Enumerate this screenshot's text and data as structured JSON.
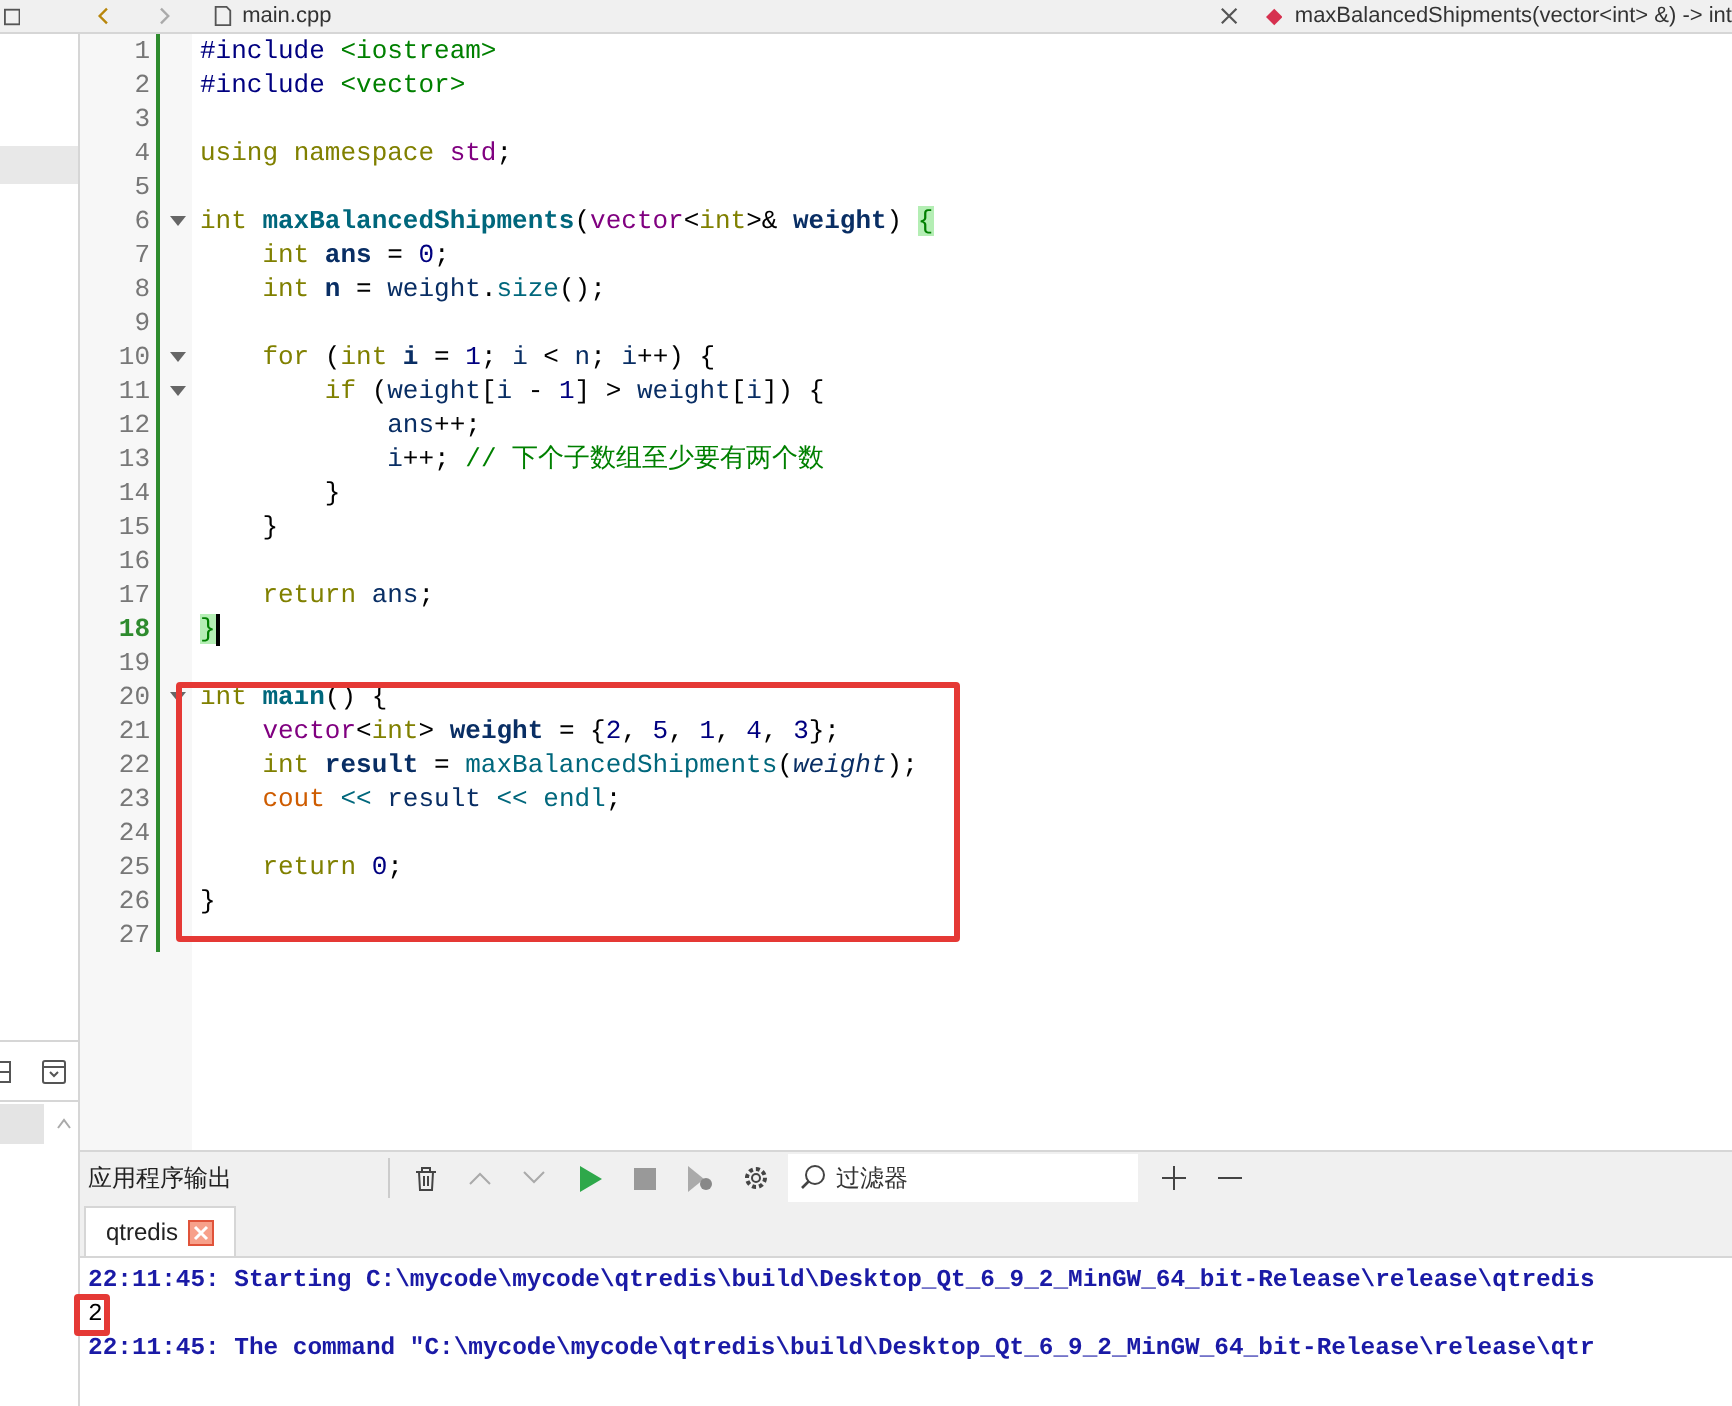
{
  "toolbar": {
    "file": "main.cpp",
    "symbol": "maxBalancedShipments(vector<int> &) -> int"
  },
  "editor": {
    "lines": [
      {
        "number": "1",
        "fold": false,
        "current": false,
        "tokens": [
          {
            "text": "#include",
            "kind": "pp"
          },
          {
            "text": " <iostream>",
            "kind": "inc"
          }
        ]
      },
      {
        "number": "2",
        "fold": false,
        "current": false,
        "tokens": [
          {
            "text": "#include",
            "kind": "pp"
          },
          {
            "text": " <vector>",
            "kind": "inc"
          }
        ]
      },
      {
        "number": "3",
        "fold": false,
        "current": false
      },
      {
        "number": "4",
        "fold": false,
        "current": false,
        "tokens": [
          {
            "text": "using",
            "kind": "kw"
          },
          {
            "text": " namespace",
            "kind": "kw"
          },
          {
            "text": " std",
            "kind": "type"
          },
          {
            "text": ";",
            "kind": "p"
          }
        ]
      },
      {
        "number": "5",
        "fold": false,
        "current": false
      },
      {
        "number": "6",
        "fold": true,
        "current": false,
        "tokens": [
          {
            "text": "int",
            "kind": "kw"
          },
          {
            "text": " maxBalancedShipments",
            "kind": "fndecl"
          },
          {
            "text": "(",
            "kind": "p"
          },
          {
            "text": "vector",
            "kind": "type"
          },
          {
            "text": "<",
            "kind": "p"
          },
          {
            "text": "int",
            "kind": "kw"
          },
          {
            "text": ">& ",
            "kind": "p"
          },
          {
            "text": "weight",
            "kind": "local"
          },
          {
            "text": ") ",
            "kind": "p"
          },
          {
            "text": "{",
            "kind": "match"
          }
        ]
      },
      {
        "number": "7",
        "fold": false,
        "current": false,
        "tokens": [
          {
            "text": "    int",
            "kind": "kw"
          },
          {
            "text": " ans",
            "kind": "local"
          },
          {
            "text": " = ",
            "kind": "p"
          },
          {
            "text": "0",
            "kind": "num"
          },
          {
            "text": ";",
            "kind": "p"
          }
        ]
      },
      {
        "number": "8",
        "fold": false,
        "current": false,
        "tokens": [
          {
            "text": "    int",
            "kind": "kw"
          },
          {
            "text": " n",
            "kind": "local"
          },
          {
            "text": " = ",
            "kind": "p"
          },
          {
            "text": "weight",
            "kind": "var"
          },
          {
            "text": ".",
            "kind": "p"
          },
          {
            "text": "size",
            "kind": "fn"
          },
          {
            "text": "();",
            "kind": "p"
          }
        ]
      },
      {
        "number": "9",
        "fold": false,
        "current": false
      },
      {
        "number": "10",
        "fold": true,
        "current": false,
        "tokens": [
          {
            "text": "    for",
            "kind": "kw"
          },
          {
            "text": " (",
            "kind": "p"
          },
          {
            "text": "int",
            "kind": "kw"
          },
          {
            "text": " i",
            "kind": "local"
          },
          {
            "text": " = ",
            "kind": "p"
          },
          {
            "text": "1",
            "kind": "num"
          },
          {
            "text": "; ",
            "kind": "p"
          },
          {
            "text": "i",
            "kind": "var"
          },
          {
            "text": " < ",
            "kind": "p"
          },
          {
            "text": "n",
            "kind": "var"
          },
          {
            "text": "; ",
            "kind": "p"
          },
          {
            "text": "i",
            "kind": "var"
          },
          {
            "text": "++) {",
            "kind": "p"
          }
        ]
      },
      {
        "number": "11",
        "fold": true,
        "current": false,
        "tokens": [
          {
            "text": "        if",
            "kind": "kw"
          },
          {
            "text": " (",
            "kind": "p"
          },
          {
            "text": "weight",
            "kind": "var"
          },
          {
            "text": "[",
            "kind": "p"
          },
          {
            "text": "i",
            "kind": "var"
          },
          {
            "text": " - ",
            "kind": "p"
          },
          {
            "text": "1",
            "kind": "num"
          },
          {
            "text": "] > ",
            "kind": "p"
          },
          {
            "text": "weight",
            "kind": "var"
          },
          {
            "text": "[",
            "kind": "p"
          },
          {
            "text": "i",
            "kind": "var"
          },
          {
            "text": "]) {",
            "kind": "p"
          }
        ]
      },
      {
        "number": "12",
        "fold": false,
        "current": false,
        "tokens": [
          {
            "text": "            ans",
            "kind": "var"
          },
          {
            "text": "++;",
            "kind": "p"
          }
        ]
      },
      {
        "number": "13",
        "fold": false,
        "current": false,
        "tokens": [
          {
            "text": "            i",
            "kind": "var"
          },
          {
            "text": "++; ",
            "kind": "p"
          },
          {
            "text": "// 下个子数组至少要有两个数",
            "kind": "cmt"
          }
        ]
      },
      {
        "number": "14",
        "fold": false,
        "current": false,
        "tokens": [
          {
            "text": "        }",
            "kind": "p"
          }
        ]
      },
      {
        "number": "15",
        "fold": false,
        "current": false,
        "tokens": [
          {
            "text": "    }",
            "kind": "p"
          }
        ]
      },
      {
        "number": "16",
        "fold": false,
        "current": false
      },
      {
        "number": "17",
        "fold": false,
        "current": false,
        "tokens": [
          {
            "text": "    return",
            "kind": "kw"
          },
          {
            "text": " ans",
            "kind": "var"
          },
          {
            "text": ";",
            "kind": "p"
          }
        ]
      },
      {
        "number": "18",
        "fold": false,
        "current": true,
        "tokens": [
          {
            "text": "}",
            "kind": "match"
          }
        ]
      },
      {
        "number": "19",
        "fold": false,
        "current": false
      },
      {
        "number": "20",
        "fold": true,
        "current": false,
        "tokens": [
          {
            "text": "int",
            "kind": "kw"
          },
          {
            "text": " main",
            "kind": "fndecl"
          },
          {
            "text": "() {",
            "kind": "p"
          }
        ]
      },
      {
        "number": "21",
        "fold": false,
        "current": false,
        "tokens": [
          {
            "text": "    vector",
            "kind": "type"
          },
          {
            "text": "<",
            "kind": "p"
          },
          {
            "text": "int",
            "kind": "kw"
          },
          {
            "text": "> ",
            "kind": "p"
          },
          {
            "text": "weight",
            "kind": "local"
          },
          {
            "text": " = {",
            "kind": "p"
          },
          {
            "text": "2",
            "kind": "num"
          },
          {
            "text": ", ",
            "kind": "p"
          },
          {
            "text": "5",
            "kind": "num"
          },
          {
            "text": ", ",
            "kind": "p"
          },
          {
            "text": "1",
            "kind": "num"
          },
          {
            "text": ", ",
            "kind": "p"
          },
          {
            "text": "4",
            "kind": "num"
          },
          {
            "text": ", ",
            "kind": "p"
          },
          {
            "text": "3",
            "kind": "num"
          },
          {
            "text": "};",
            "kind": "p"
          }
        ]
      },
      {
        "number": "22",
        "fold": false,
        "current": false,
        "tokens": [
          {
            "text": "    int",
            "kind": "kw"
          },
          {
            "text": " result",
            "kind": "local"
          },
          {
            "text": " = ",
            "kind": "p"
          },
          {
            "text": "maxBalancedShipments",
            "kind": "fn"
          },
          {
            "text": "(",
            "kind": "p"
          },
          {
            "text": "weight",
            "kind": "outparam"
          },
          {
            "text": ");",
            "kind": "p"
          }
        ]
      },
      {
        "number": "23",
        "fold": false,
        "current": false,
        "tokens": [
          {
            "text": "    cout",
            "kind": "glob"
          },
          {
            "text": " <<",
            "kind": "op"
          },
          {
            "text": " result",
            "kind": "var"
          },
          {
            "text": " <<",
            "kind": "op"
          },
          {
            "text": " endl",
            "kind": "fn"
          },
          {
            "text": ";",
            "kind": "p"
          }
        ]
      },
      {
        "number": "24",
        "fold": false,
        "current": false
      },
      {
        "number": "25",
        "fold": false,
        "current": false,
        "tokens": [
          {
            "text": "    return",
            "kind": "kw"
          },
          {
            "text": " 0",
            "kind": "num"
          },
          {
            "text": ";",
            "kind": "p"
          }
        ]
      },
      {
        "number": "26",
        "fold": false,
        "current": false,
        "tokens": [
          {
            "text": "}",
            "kind": "p"
          }
        ]
      },
      {
        "number": "27",
        "fold": false,
        "current": false
      }
    ]
  },
  "output": {
    "title": "应用程序输出",
    "filter_placeholder": "过滤器",
    "tabs": [
      {
        "label": "qtredis",
        "selected": true
      }
    ],
    "lines": [
      {
        "kind": "log",
        "text": "22:11:45: Starting C:\\mycode\\mycode\\qtredis\\build\\Desktop_Qt_6_9_2_MinGW_64_bit-Release\\release\\qtredis"
      },
      {
        "kind": "stdout",
        "text": "2"
      },
      {
        "kind": "log",
        "text": "22:11:45: The command \"C:\\mycode\\mycode\\qtredis\\build\\Desktop_Qt_6_9_2_MinGW_64_bit-Release\\release\\qtr"
      }
    ]
  }
}
